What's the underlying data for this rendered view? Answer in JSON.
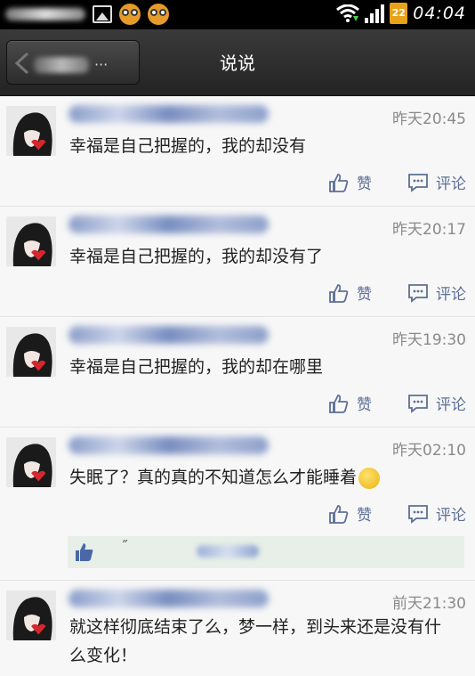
{
  "status_bar": {
    "icons": [
      "blurred-notification",
      "image-icon",
      "owl-app-icon",
      "owl-app-icon",
      "wifi-icon",
      "signal-icon"
    ],
    "battery": "22",
    "time": "04:04"
  },
  "header": {
    "back_label": "···",
    "title": "说说"
  },
  "posts": [
    {
      "time": "昨天20:45",
      "text": "幸福是自己把握的，我的却没有",
      "like_label": "赞",
      "comment_label": "评论"
    },
    {
      "time": "昨天20:17",
      "text": "幸福是自己把握的，我的却没有了",
      "like_label": "赞",
      "comment_label": "评论"
    },
    {
      "time": "昨天19:30",
      "text": "幸福是自己把握的，我的却在哪里",
      "like_label": "赞",
      "comment_label": "评论"
    },
    {
      "time": "昨天02:10",
      "text": "失眠了？真的真的不知道怎么才能睡着",
      "like_label": "赞",
      "comment_label": "评论",
      "liked_by_mark": "˝"
    },
    {
      "time": "前天21:30",
      "text": "就这样彻底结束了么，梦一样，到头来还是没有什么变化！"
    }
  ],
  "colors": {
    "title_bar": "#2b2b2b",
    "action_text": "#5d6f95",
    "time_text": "#8a8a8a",
    "battery": "#e7a21b",
    "like_bar": "#e8efe8"
  }
}
